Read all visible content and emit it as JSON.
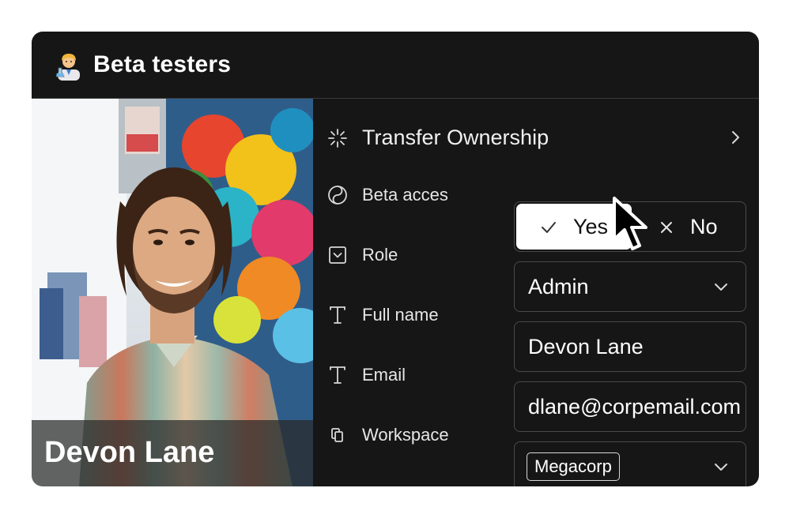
{
  "header": {
    "title": "Beta testers",
    "emoji": "scientist-emoji"
  },
  "profile": {
    "name": "Devon Lane",
    "photo": "profile-photo"
  },
  "form": {
    "transfer": {
      "label": "Transfer Ownership",
      "icon": "loader-icon",
      "chevron": "chevron-right-icon"
    },
    "beta_access": {
      "label": "Beta acces",
      "icon": "yin-yang-icon",
      "options": [
        {
          "label": "Yes",
          "icon": "check-icon",
          "selected": true
        },
        {
          "label": "No",
          "icon": "close-icon",
          "selected": false
        }
      ]
    },
    "role": {
      "label": "Role",
      "icon": "dropdown-box-icon",
      "value": "Admin"
    },
    "full_name": {
      "label": "Full name",
      "icon": "text-icon",
      "value": "Devon Lane"
    },
    "email": {
      "label": "Email",
      "icon": "text-icon",
      "value": "dlane@corpemail.com"
    },
    "workspace": {
      "label": "Workspace",
      "icon": "copy-icon",
      "value": "Megacorp"
    }
  },
  "colors": {
    "card_bg": "#161616",
    "border": "#4a4a4a",
    "text": "#ffffff",
    "selected_bg": "#ffffff"
  }
}
